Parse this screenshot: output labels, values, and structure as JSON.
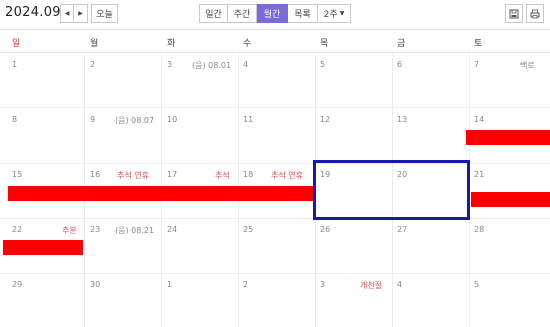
{
  "header": {
    "title": "2024.09"
  },
  "nav": {
    "prev_icon": "chevron-left-icon",
    "next_icon": "chevron-right-icon",
    "today_label": "오늘"
  },
  "views": [
    {
      "label": "일간",
      "active": false
    },
    {
      "label": "주간",
      "active": false
    },
    {
      "label": "월간",
      "active": true
    },
    {
      "label": "목록",
      "active": false
    },
    {
      "label": "2주",
      "active": false
    }
  ],
  "actions": {
    "save_icon": "save-icon",
    "print_icon": "print-icon"
  },
  "weekdays": [
    "일",
    "월",
    "화",
    "수",
    "목",
    "금",
    "토"
  ],
  "weeks": [
    [
      "1",
      "2",
      "3",
      "4",
      "5",
      "6",
      "7"
    ],
    [
      "8",
      "9",
      "10",
      "11",
      "12",
      "13",
      "14"
    ],
    [
      "15",
      "16",
      "17",
      "18",
      "19",
      "20",
      "21"
    ],
    [
      "22",
      "23",
      "24",
      "25",
      "26",
      "27",
      "28"
    ],
    [
      "29",
      "30",
      "1",
      "2",
      "3",
      "4",
      "5"
    ]
  ],
  "annotations": {
    "w0_tue": "(음) 08.01",
    "w0_sat": "백로",
    "w1_mon": "(음) 08.07",
    "w2_mon": "추석 연휴",
    "w2_tue": "추석",
    "w2_wed": "추석 연휴",
    "w3_sun": "추분",
    "w3_mon": "(음) 08.21",
    "w4_thu": "개천절"
  },
  "colors": {
    "accent": "#7a6bd6",
    "event_bar": "#ff0000",
    "highlight_border": "#1a1aa8",
    "sunday": "#dd3333"
  }
}
